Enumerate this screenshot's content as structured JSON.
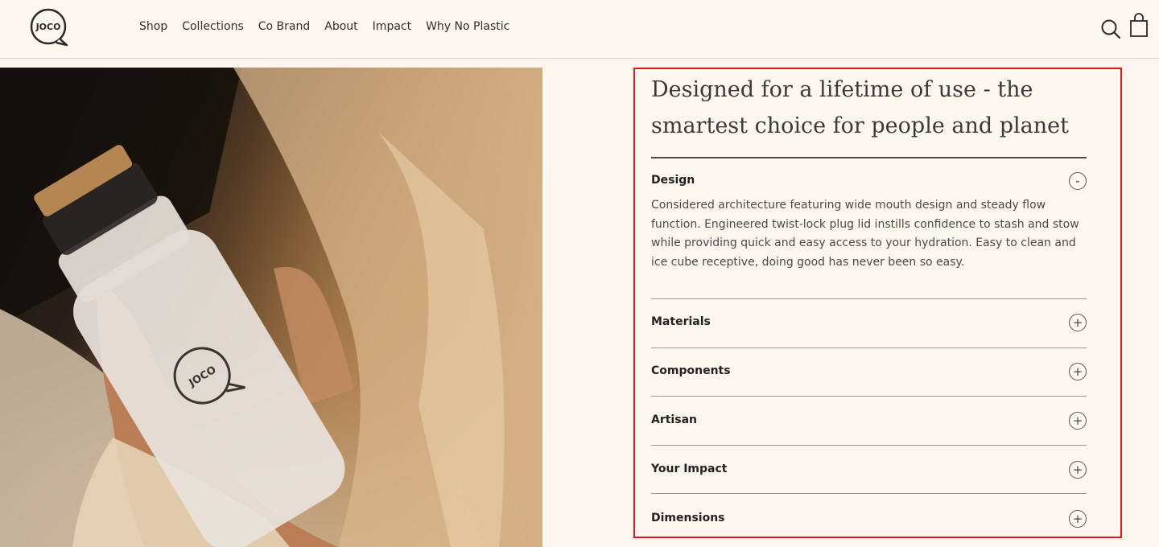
{
  "brand": {
    "logo_text": "JOCO"
  },
  "nav": {
    "items": [
      {
        "label": "Shop"
      },
      {
        "label": "Collections"
      },
      {
        "label": "Co Brand"
      },
      {
        "label": "About"
      },
      {
        "label": "Impact"
      },
      {
        "label": "Why No Plastic"
      }
    ]
  },
  "header_icons": {
    "search": "search-icon",
    "cart": "shopping-bag-icon"
  },
  "hero": {
    "bottle_logo_text": "JOCO"
  },
  "panel": {
    "title_line1": "Designed for a lifetime of use - the",
    "title_line2": "smartest choice for people and planet",
    "accordion": [
      {
        "label": "Design",
        "expanded": true,
        "toggle": "-",
        "body": "Considered architecture featuring wide mouth design and steady flow function. Engineered twist-lock plug lid instills confidence to stash and stow while providing quick and easy access to your hydration. Easy to clean and ice cube receptive, doing good has never been so easy."
      },
      {
        "label": "Materials",
        "expanded": false,
        "toggle": "+"
      },
      {
        "label": "Components",
        "expanded": false,
        "toggle": "+"
      },
      {
        "label": "Artisan",
        "expanded": false,
        "toggle": "+"
      },
      {
        "label": "Your Impact",
        "expanded": false,
        "toggle": "+"
      },
      {
        "label": "Dimensions",
        "expanded": false,
        "toggle": "+"
      }
    ]
  },
  "colors": {
    "background": "#fdf6ee",
    "highlight_border": "#e0161b",
    "text_dark": "#2b2b2b"
  }
}
